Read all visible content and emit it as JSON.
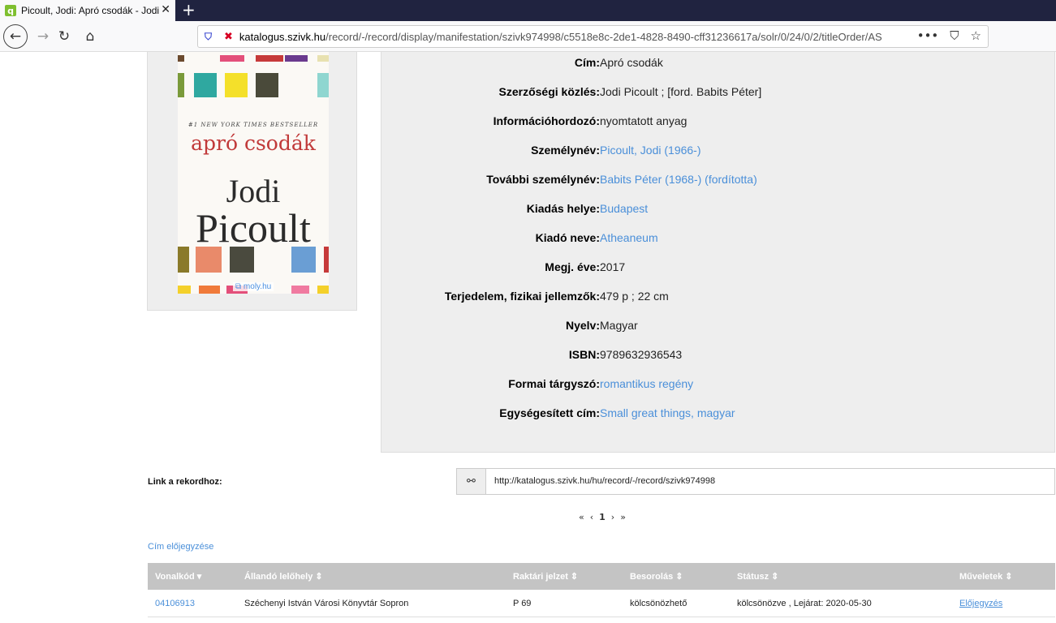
{
  "browser": {
    "tab_title": "Picoult, Jodi: Apró csodák - Jodi Picoult",
    "tab_favicon": "q",
    "url_domain": "katalogus.szivk.hu",
    "url_path": "/record/-/record/display/manifestation/szivk974998/c5518e8c-2de1-4828-8490-cff31236617a/solr/0/24/0/2/titleOrder/AS"
  },
  "cover": {
    "bestseller": "#1 NEW YORK TIMES BESTSELLER",
    "title": "apró csodák",
    "author_first": "Jodi",
    "author_last": "Picoult",
    "source": "moly.hu"
  },
  "details": [
    {
      "label": "Cím:",
      "value": "Apró csodák",
      "link": false
    },
    {
      "label": "Szerzőségi közlés:",
      "value": "Jodi Picoult ; [ford. Babits Péter]",
      "link": false
    },
    {
      "label": "Információhordozó:",
      "value": "nyomtatott anyag",
      "link": false
    },
    {
      "label": "Személynév:",
      "value": "Picoult, Jodi (1966-)",
      "link": true
    },
    {
      "label": "További személynév:",
      "value": "Babits Péter (1968-) (fordította)",
      "link": true
    },
    {
      "label": "Kiadás helye:",
      "value": "Budapest",
      "link": true
    },
    {
      "label": "Kiadó neve:",
      "value": "Atheaneum",
      "link": true
    },
    {
      "label": "Megj. éve:",
      "value": "2017",
      "link": false
    },
    {
      "label": "Terjedelem, fizikai jellemzők:",
      "value": "479 p ; 22 cm",
      "link": false
    },
    {
      "label": "Nyelv:",
      "value": "Magyar",
      "link": false
    },
    {
      "label": "ISBN:",
      "value": "9789632936543",
      "link": false
    },
    {
      "label": "Formai tárgyszó:",
      "value": "romantikus regény",
      "link": true
    },
    {
      "label": "Egységesített cím:",
      "value": "Small great things, magyar",
      "link": true
    }
  ],
  "record_link": {
    "label": "Link a rekordhoz:",
    "url": "http://katalogus.szivk.hu/hu/record/-/record/szivk974998"
  },
  "pager": {
    "first": "«",
    "prev": "‹",
    "current": "1",
    "next": "›",
    "last": "»"
  },
  "reserve_title": "Cím előjegyzése",
  "table": {
    "headers": [
      "Vonalkód ▾",
      "Állandó lelőhely ⇕",
      "Raktári jelzet ⇕",
      "Besorolás ⇕",
      "Státusz ⇕",
      "Műveletek ⇕"
    ],
    "rows": [
      [
        "04106913",
        "Széchenyi István Városi Könyvtár Sopron",
        "P 69",
        "kölcsönözhető",
        "kölcsönözve , Lejárat: 2020-05-30",
        "Előjegyzés"
      ]
    ]
  },
  "colors": {
    "link": "#4a8fd9",
    "panel": "#eeeeee",
    "table_header": "#c4c4c4"
  }
}
